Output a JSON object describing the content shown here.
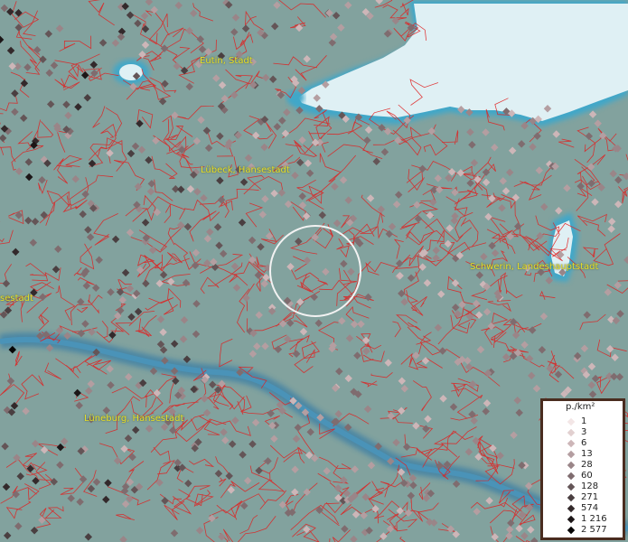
{
  "map": {
    "cities": [
      {
        "name": "Eutin, Stadt"
      },
      {
        "name": "Lübeck, Hansestadt"
      },
      {
        "name": "Schwerin, Landeshauptstadt"
      },
      {
        "name": "Lüneburg, Hansestadt"
      },
      {
        "name": "sestadt"
      }
    ],
    "colors": {
      "land": "#7f9f9c",
      "sea": "#dff0f4",
      "sea_edge": "#3fa7c9",
      "river": "#3a7fa6",
      "borders": "#e02020",
      "label": "#e8e02a"
    }
  },
  "legend": {
    "title": "p./km²",
    "items": [
      {
        "label": "1",
        "color": "#f3e6e6"
      },
      {
        "label": "3",
        "color": "#e2d0d0"
      },
      {
        "label": "6",
        "color": "#cdb6b8"
      },
      {
        "label": "13",
        "color": "#b49ea1"
      },
      {
        "label": "28",
        "color": "#9a8588"
      },
      {
        "label": "60",
        "color": "#7f6c6f"
      },
      {
        "label": "128",
        "color": "#645557"
      },
      {
        "label": "271",
        "color": "#4a3f41"
      },
      {
        "label": "574",
        "color": "#33292b"
      },
      {
        "label": "1 216",
        "color": "#1c1617"
      },
      {
        "label": "2 577",
        "color": "#070505"
      }
    ]
  }
}
